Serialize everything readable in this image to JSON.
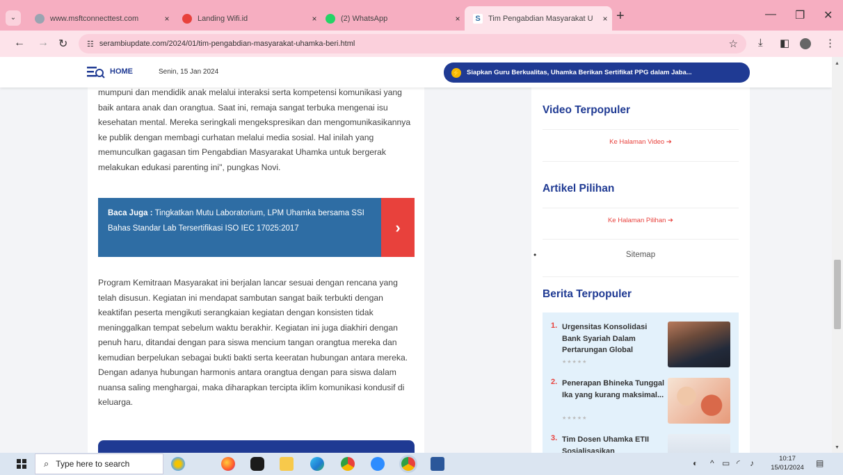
{
  "browser": {
    "tabs": [
      {
        "title": "www.msftconnecttest.com",
        "close": "×"
      },
      {
        "title": "Landing Wifi.id",
        "close": "×"
      },
      {
        "title": "(2) WhatsApp",
        "close": "×"
      },
      {
        "title": "Tim Pengabdian Masyarakat U",
        "close": "×"
      }
    ],
    "new_tab": "+",
    "tab_menu": "⌄",
    "url": "serambiupdate.com/2024/01/tim-pengabdian-masyarakat-uhamka-beri.html",
    "controls": {
      "minimize": "—",
      "maximize": "❐",
      "close": "✕"
    }
  },
  "site": {
    "home_label": "HOME",
    "date": "Senin, 15 Jan 2024",
    "ticker": "Siapkan Guru Berkualitas, Uhamka Berikan Sertifikat PPG dalam Jaba..."
  },
  "article": {
    "para1": "mumpuni dan mendidik anak melalui interaksi serta kompetensi komunikasi yang baik antara anak dan orangtua. Saat ini, remaja sangat terbuka mengenai isu kesehatan mental. Mereka seringkali mengekspresikan dan mengomunikasikannya ke publik dengan membagi curhatan melalui media sosial. Hal inilah yang memunculkan gagasan tim Pengabdian Masyarakat Uhamka untuk bergerak melakukan edukasi parenting ini\", pungkas Novi.",
    "baca_juga_label": "Baca Juga :",
    "baca_juga_text": "Tingkatkan Mutu Laboratorium, LPM Uhamka bersama SSI Bahas Standar Lab Tersertifikasi ISO IEC 17025:2017",
    "baca_juga_arrow": "›",
    "para2": "Program Kemitraan Masyarakat ini berjalan lancar sesuai dengan rencana yang telah disusun. Kegiatan ini mendapat sambutan sangat baik terbukti dengan keaktifan peserta mengikuti serangkaian kegiatan dengan konsisten tidak meninggalkan tempat sebelum waktu berakhir. Kegiatan ini juga diakhiri dengan penuh haru, ditandai dengan para siswa mencium tangan orangtua mereka dan kemudian berpelukan sebagai bukti bakti serta keeratan hubungan antara mereka. Dengan adanya hubungan harmonis antara orangtua dengan para siswa dalam nuansa saling menghargai, maka diharapkan tercipta iklim komunikasi kondusif di keluarga."
  },
  "sidebar": {
    "video_title": "Video Terpopuler",
    "video_link": "Ke Halaman Video ➔",
    "pilihan_title": "Artikel Pilihan",
    "pilihan_link": "Ke Halaman Pilihan ➔",
    "sitemap": "Sitemap",
    "berita_title": "Berita Terpopuler",
    "popular": [
      {
        "num": "1.",
        "title": "Urgensitas Konsolidasi Bank Syariah Dalam Pertarungan Global",
        "stars": "★★★★★"
      },
      {
        "num": "2.",
        "title": "Penerapan Bhineka Tunggal Ika yang kurang maksimal...",
        "stars": "★★★★★"
      },
      {
        "num": "3.",
        "title": "Tim Dosen Uhamka ETII Sosialisasikan",
        "stars": ""
      }
    ]
  },
  "taskbar": {
    "search_placeholder": "Type here to search",
    "time": "10:17",
    "date": "15/01/2024"
  }
}
